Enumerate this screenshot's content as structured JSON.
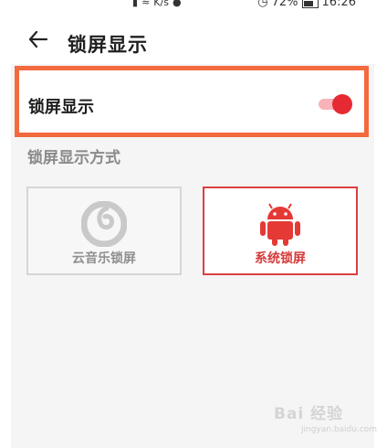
{
  "status": {
    "network": "K/s",
    "battery": "72%",
    "time": "16:26"
  },
  "header": {
    "title": "锁屏显示"
  },
  "setting": {
    "label": "锁屏显示",
    "enabled": true
  },
  "section": {
    "title": "锁屏显示方式"
  },
  "options": [
    {
      "label": "云音乐锁屏",
      "selected": false,
      "icon": "netease-cloud-music-icon"
    },
    {
      "label": "系统锁屏",
      "selected": true,
      "icon": "android-icon"
    }
  ],
  "watermark": {
    "brand": "Bai 经验",
    "subtitle": "jingyan.baidu.com"
  },
  "colors": {
    "accent": "#e52a33",
    "highlight_border": "#f26a3d"
  }
}
